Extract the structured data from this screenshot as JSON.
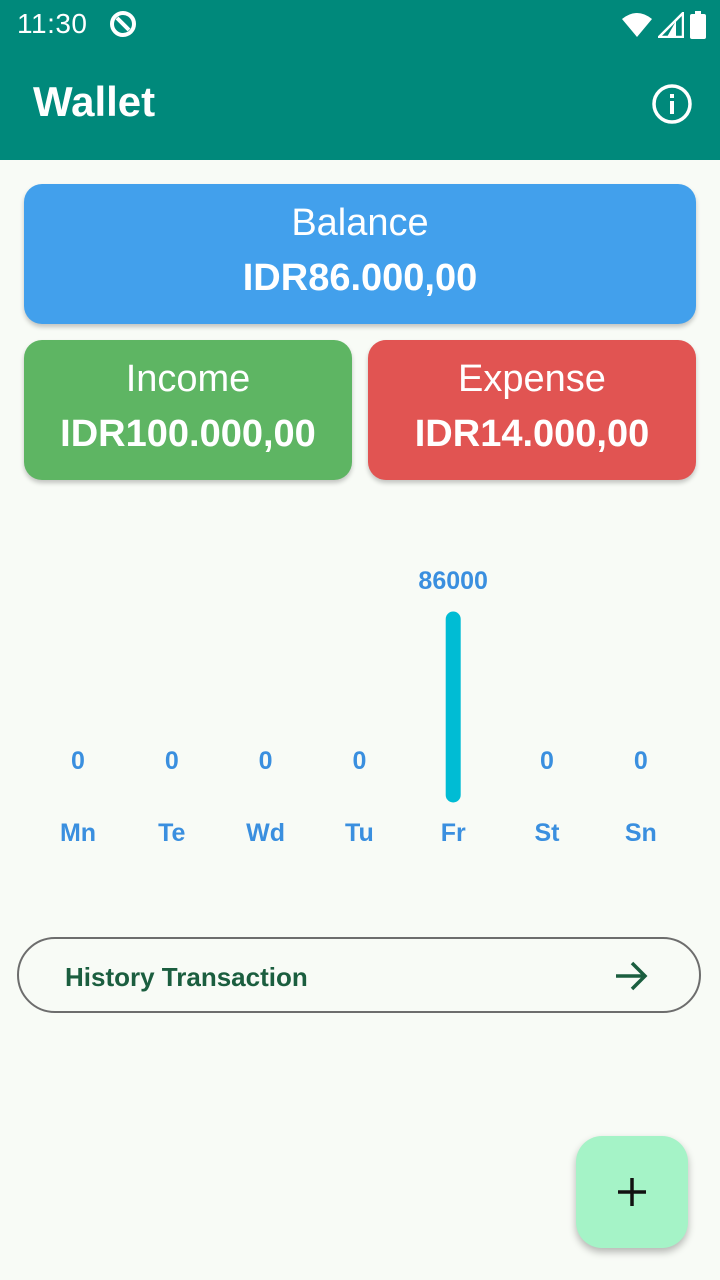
{
  "status_bar": {
    "time": "11:30"
  },
  "app_bar": {
    "title": "Wallet",
    "info_icon": "info-icon"
  },
  "balance": {
    "label": "Balance",
    "amount": "IDR86.000,00"
  },
  "income": {
    "label": "Income",
    "amount": "IDR100.000,00"
  },
  "expense": {
    "label": "Expense",
    "amount": "IDR14.000,00"
  },
  "chart_data": {
    "type": "bar",
    "categories": [
      "Mn",
      "Te",
      "Wd",
      "Tu",
      "Fr",
      "St",
      "Sn"
    ],
    "values": [
      0,
      0,
      0,
      0,
      86000,
      0,
      0
    ],
    "value_labels": [
      "0",
      "0",
      "0",
      "0",
      "86000",
      "0",
      "0"
    ],
    "bar_color": "#00bcd4",
    "label_color": "#3a8fdf"
  },
  "history": {
    "label": "History Transaction",
    "icon": "arrow-right-icon"
  },
  "fab": {
    "icon": "plus-icon"
  },
  "colors": {
    "primary": "#00897b",
    "balance": "#42a0ec",
    "income": "#5eb563",
    "expense": "#e15452",
    "fab": "#a5f3c7"
  }
}
